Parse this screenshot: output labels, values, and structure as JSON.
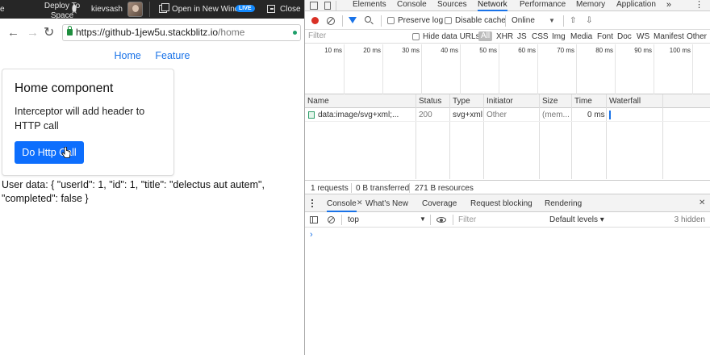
{
  "stackblitz_bar": {
    "edge_text": "e",
    "deploy_label": "Deploy To Space",
    "username": "kievsash",
    "open_new_window_label": "Open in New Window",
    "live_badge": "LIVE",
    "close_label": "Close"
  },
  "browser": {
    "url_host": "https://github-1jew5u.stackblitz.io",
    "url_path": "/home"
  },
  "app": {
    "nav": [
      "Home",
      "Feature"
    ],
    "card": {
      "title": "Home component",
      "text": "Interceptor will add header to HTTP call",
      "button_label": "Do Http Call"
    },
    "user_data": "User data: { \"userId\": 1, \"id\": 1, \"title\": \"delectus aut autem\", \"completed\": false }"
  },
  "devtools": {
    "main_tabs": [
      "Elements",
      "Console",
      "Sources",
      "Network",
      "Performance",
      "Memory",
      "Application"
    ],
    "active_tab": "Network",
    "overflow_label": "»",
    "network_toolbar": {
      "preserve_log": "Preserve log",
      "disable_cache": "Disable cache",
      "throttle": "Online"
    },
    "filter_bar": {
      "placeholder": "Filter",
      "hide_data_urls": "Hide data URLs",
      "types": [
        "All",
        "XHR",
        "JS",
        "CSS",
        "Img",
        "Media",
        "Font",
        "Doc",
        "WS",
        "Manifest",
        "Other"
      ]
    },
    "timeline_ticks": [
      "10 ms",
      "20 ms",
      "30 ms",
      "40 ms",
      "50 ms",
      "60 ms",
      "70 ms",
      "80 ms",
      "90 ms",
      "100 ms"
    ],
    "table": {
      "columns": [
        "Name",
        "Status",
        "Type",
        "Initiator",
        "Size",
        "Time",
        "Waterfall"
      ],
      "rows": [
        {
          "name": "data:image/svg+xml;...",
          "status": "200",
          "type": "svg+xml",
          "initiator": "Other",
          "size": "(mem...",
          "time": "0 ms"
        }
      ]
    },
    "summary": {
      "requests": "1 requests",
      "transferred": "0 B transferred",
      "resources": "271 B resources"
    },
    "drawer_tabs": [
      "Console",
      "What's New",
      "Coverage",
      "Request blocking",
      "Rendering"
    ],
    "console_toolbar": {
      "context": "top",
      "filter_placeholder": "Filter",
      "levels": "Default levels ▾",
      "hidden": "3 hidden"
    },
    "prompt": "›"
  }
}
